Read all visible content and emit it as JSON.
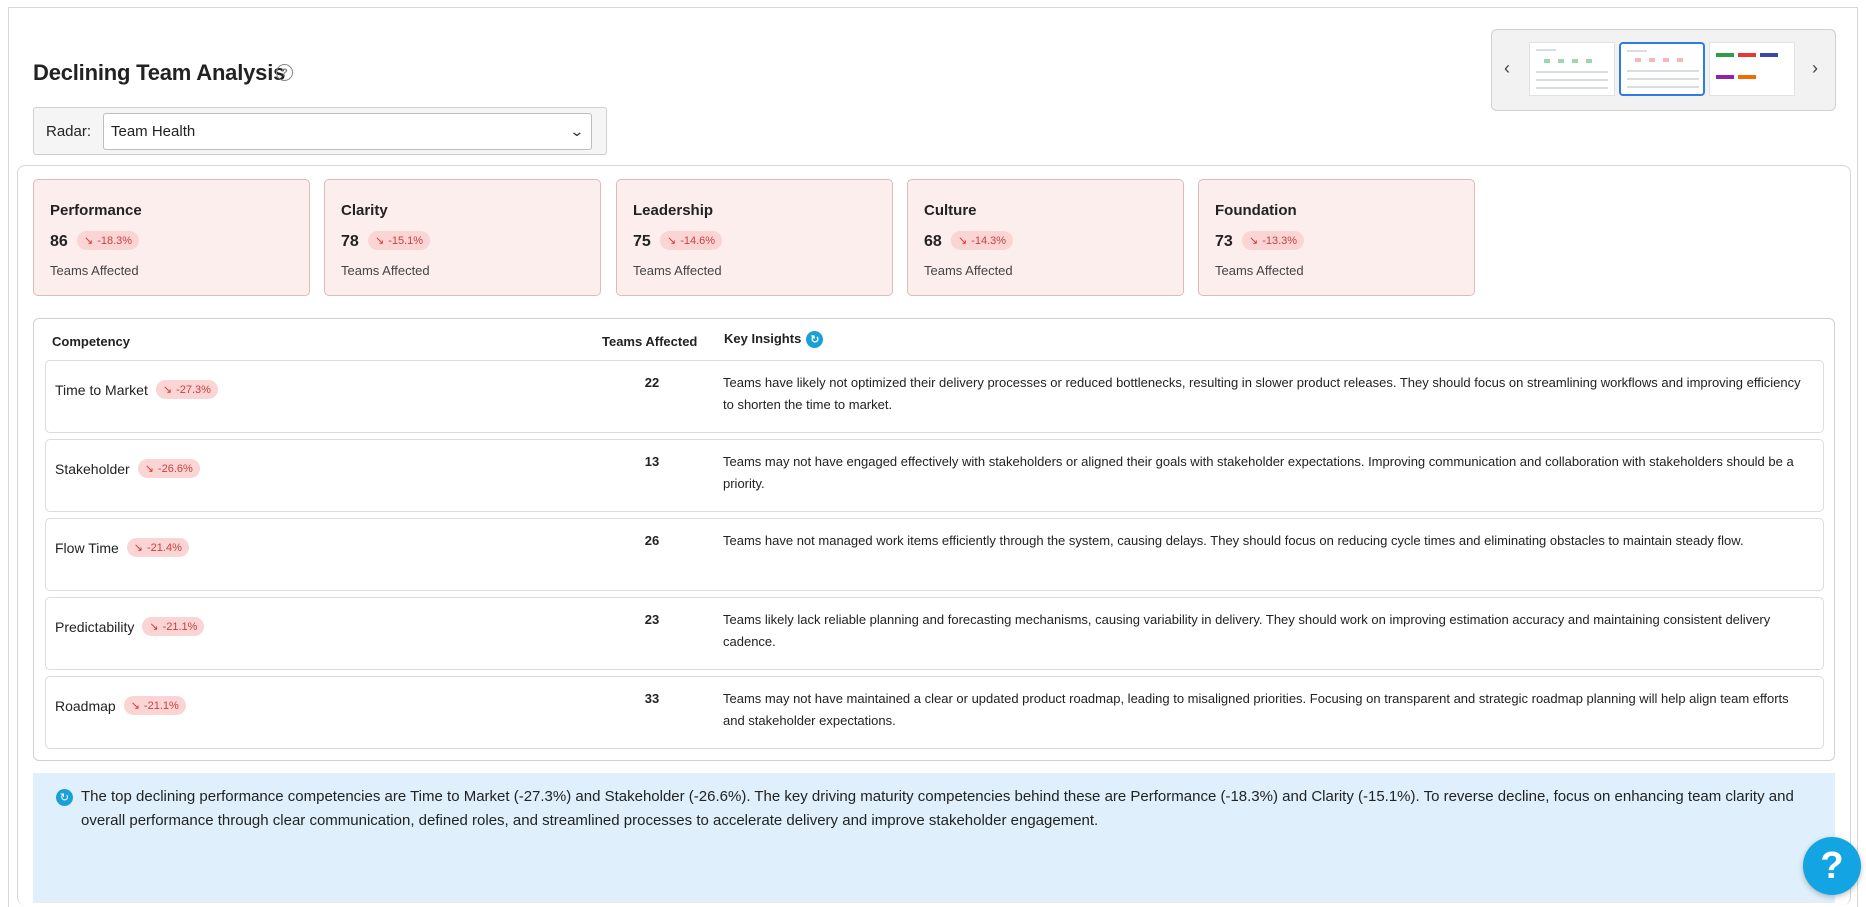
{
  "header": {
    "title": "Declining Team Analysis",
    "help_icon": "question-circle-icon"
  },
  "radar": {
    "label": "Radar:",
    "selected": "Team Health"
  },
  "thumbnails": {
    "prev": "‹",
    "next": "›"
  },
  "cards": [
    {
      "title": "Performance",
      "value": "86",
      "change": "-18.3%",
      "subtitle": "Teams Affected"
    },
    {
      "title": "Clarity",
      "value": "78",
      "change": "-15.1%",
      "subtitle": "Teams Affected"
    },
    {
      "title": "Leadership",
      "value": "75",
      "change": "-14.6%",
      "subtitle": "Teams Affected"
    },
    {
      "title": "Culture",
      "value": "68",
      "change": "-14.3%",
      "subtitle": "Teams Affected"
    },
    {
      "title": "Foundation",
      "value": "73",
      "change": "-13.3%",
      "subtitle": "Teams Affected"
    }
  ],
  "table": {
    "headers": {
      "competency": "Competency",
      "teams": "Teams Affected",
      "insights": "Key Insights"
    },
    "rows": [
      {
        "name": "Time to Market",
        "change": "-27.3%",
        "teams": "22",
        "insight": "Teams have likely not optimized their delivery processes or reduced bottlenecks, resulting in slower product releases. They should focus on streamlining workflows and improving efficiency to shorten the time to market."
      },
      {
        "name": "Stakeholder",
        "change": "-26.6%",
        "teams": "13",
        "insight": "Teams may not have engaged effectively with stakeholders or aligned their goals with stakeholder expectations. Improving communication and collaboration with stakeholders should be a priority."
      },
      {
        "name": "Flow Time",
        "change": "-21.4%",
        "teams": "26",
        "insight": "Teams have not managed work items efficiently through the system, causing delays. They should focus on reducing cycle times and eliminating obstacles to maintain steady flow."
      },
      {
        "name": "Predictability",
        "change": "-21.1%",
        "teams": "23",
        "insight": "Teams likely lack reliable planning and forecasting mechanisms, causing variability in delivery. They should work on improving estimation accuracy and maintaining consistent delivery cadence."
      },
      {
        "name": "Roadmap",
        "change": "-21.1%",
        "teams": "33",
        "insight": "Teams may not have maintained a clear or updated product roadmap, leading to misaligned priorities. Focusing on transparent and strategic roadmap planning will help align team efforts and stakeholder expectations."
      }
    ]
  },
  "summary": {
    "text": "The top declining performance competencies are Time to Market (-27.3%) and Stakeholder (-26.6%). The key driving maturity competencies behind these are Performance (-18.3%) and Clarity (-15.1%). To reverse decline, focus on enhancing team clarity and overall performance through clear communication, defined roles, and streamlined processes to accelerate delivery and improve stakeholder engagement."
  },
  "fab": {
    "label": "?"
  },
  "colors": {
    "accent": "#13a4e3",
    "card_bg": "#fdeeee",
    "decline_red": "#c94040",
    "summary_bg": "#dff0fc"
  }
}
